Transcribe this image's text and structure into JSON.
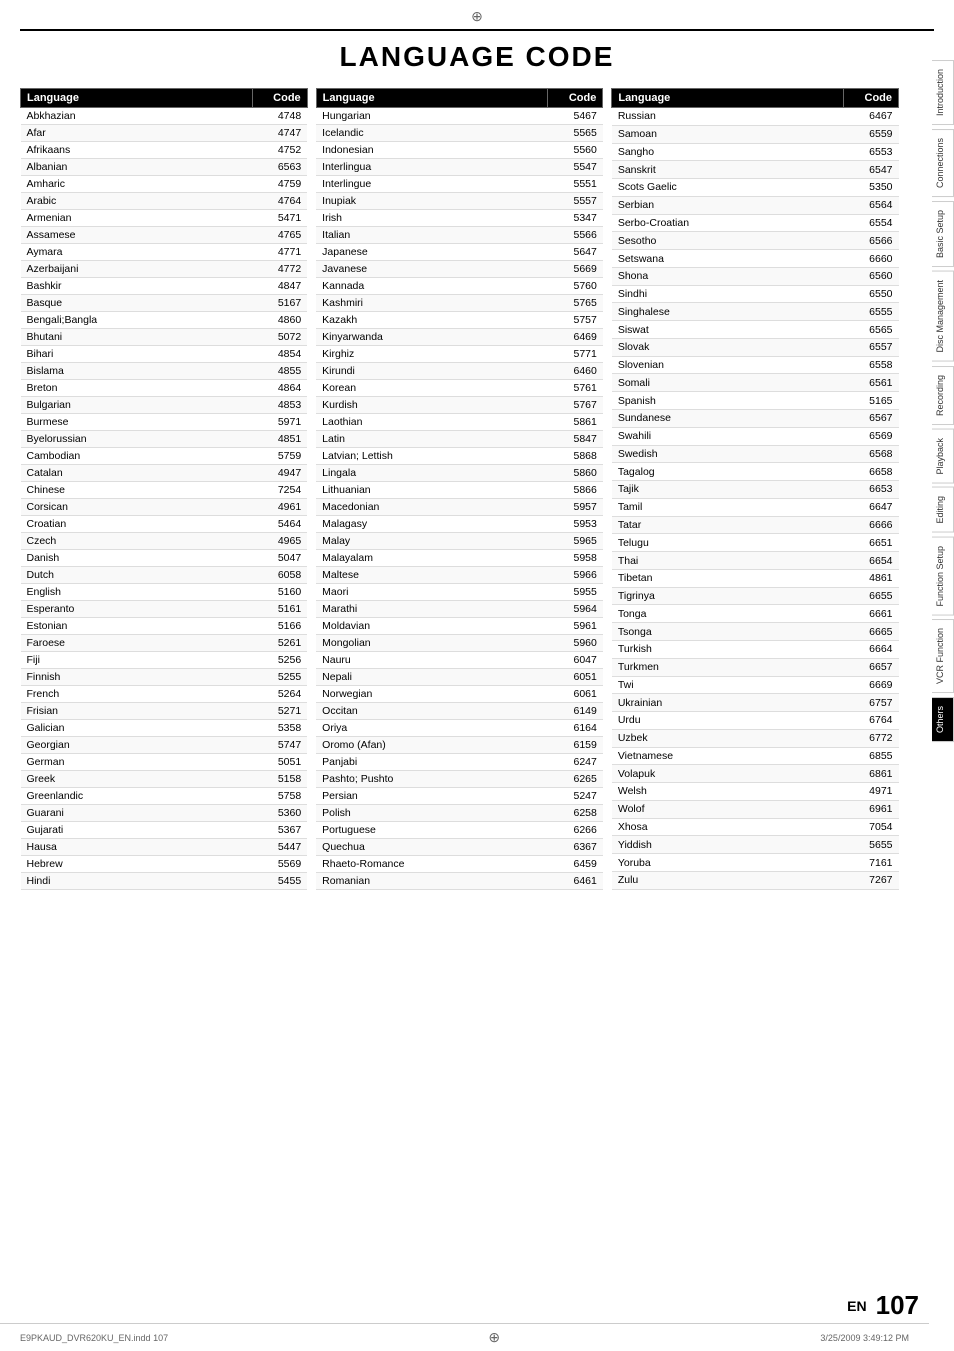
{
  "page": {
    "title": "LANGUAGE CODE",
    "top_marker": "⊕",
    "bottom_marker": "⊕",
    "en_label": "EN",
    "page_num": "107",
    "doc_info": "E9PKAUD_DVR620KU_EN.indd  107",
    "date_info": "3/25/2009  3:49:12 PM"
  },
  "sidebar": {
    "tabs": [
      {
        "label": "Introduction",
        "active": false
      },
      {
        "label": "Connections",
        "active": false
      },
      {
        "label": "Basic Setup",
        "active": false
      },
      {
        "label": "Disc Management",
        "active": false
      },
      {
        "label": "Recording",
        "active": false
      },
      {
        "label": "Playback",
        "active": false
      },
      {
        "label": "Editing",
        "active": false
      },
      {
        "label": "Function Setup",
        "active": false
      },
      {
        "label": "VCR Function",
        "active": false
      },
      {
        "label": "Others",
        "active": true
      }
    ]
  },
  "tables": [
    {
      "header": {
        "language": "Language",
        "code": "Code"
      },
      "rows": [
        {
          "language": "Abkhazian",
          "code": "4748"
        },
        {
          "language": "Afar",
          "code": "4747"
        },
        {
          "language": "Afrikaans",
          "code": "4752"
        },
        {
          "language": "Albanian",
          "code": "6563"
        },
        {
          "language": "Amharic",
          "code": "4759"
        },
        {
          "language": "Arabic",
          "code": "4764"
        },
        {
          "language": "Armenian",
          "code": "5471"
        },
        {
          "language": "Assamese",
          "code": "4765"
        },
        {
          "language": "Aymara",
          "code": "4771"
        },
        {
          "language": "Azerbaijani",
          "code": "4772"
        },
        {
          "language": "Bashkir",
          "code": "4847"
        },
        {
          "language": "Basque",
          "code": "5167"
        },
        {
          "language": "Bengali;Bangla",
          "code": "4860"
        },
        {
          "language": "Bhutani",
          "code": "5072"
        },
        {
          "language": "Bihari",
          "code": "4854"
        },
        {
          "language": "Bislama",
          "code": "4855"
        },
        {
          "language": "Breton",
          "code": "4864"
        },
        {
          "language": "Bulgarian",
          "code": "4853"
        },
        {
          "language": "Burmese",
          "code": "5971"
        },
        {
          "language": "Byelorussian",
          "code": "4851"
        },
        {
          "language": "Cambodian",
          "code": "5759"
        },
        {
          "language": "Catalan",
          "code": "4947"
        },
        {
          "language": "Chinese",
          "code": "7254"
        },
        {
          "language": "Corsican",
          "code": "4961"
        },
        {
          "language": "Croatian",
          "code": "5464"
        },
        {
          "language": "Czech",
          "code": "4965"
        },
        {
          "language": "Danish",
          "code": "5047"
        },
        {
          "language": "Dutch",
          "code": "6058"
        },
        {
          "language": "English",
          "code": "5160"
        },
        {
          "language": "Esperanto",
          "code": "5161"
        },
        {
          "language": "Estonian",
          "code": "5166"
        },
        {
          "language": "Faroese",
          "code": "5261"
        },
        {
          "language": "Fiji",
          "code": "5256"
        },
        {
          "language": "Finnish",
          "code": "5255"
        },
        {
          "language": "French",
          "code": "5264"
        },
        {
          "language": "Frisian",
          "code": "5271"
        },
        {
          "language": "Galician",
          "code": "5358"
        },
        {
          "language": "Georgian",
          "code": "5747"
        },
        {
          "language": "German",
          "code": "5051"
        },
        {
          "language": "Greek",
          "code": "5158"
        },
        {
          "language": "Greenlandic",
          "code": "5758"
        },
        {
          "language": "Guarani",
          "code": "5360"
        },
        {
          "language": "Gujarati",
          "code": "5367"
        },
        {
          "language": "Hausa",
          "code": "5447"
        },
        {
          "language": "Hebrew",
          "code": "5569"
        },
        {
          "language": "Hindi",
          "code": "5455"
        }
      ]
    },
    {
      "header": {
        "language": "Language",
        "code": "Code"
      },
      "rows": [
        {
          "language": "Hungarian",
          "code": "5467"
        },
        {
          "language": "Icelandic",
          "code": "5565"
        },
        {
          "language": "Indonesian",
          "code": "5560"
        },
        {
          "language": "Interlingua",
          "code": "5547"
        },
        {
          "language": "Interlingue",
          "code": "5551"
        },
        {
          "language": "Inupiak",
          "code": "5557"
        },
        {
          "language": "Irish",
          "code": "5347"
        },
        {
          "language": "Italian",
          "code": "5566"
        },
        {
          "language": "Japanese",
          "code": "5647"
        },
        {
          "language": "Javanese",
          "code": "5669"
        },
        {
          "language": "Kannada",
          "code": "5760"
        },
        {
          "language": "Kashmiri",
          "code": "5765"
        },
        {
          "language": "Kazakh",
          "code": "5757"
        },
        {
          "language": "Kinyarwanda",
          "code": "6469"
        },
        {
          "language": "Kirghiz",
          "code": "5771"
        },
        {
          "language": "Kirundi",
          "code": "6460"
        },
        {
          "language": "Korean",
          "code": "5761"
        },
        {
          "language": "Kurdish",
          "code": "5767"
        },
        {
          "language": "Laothian",
          "code": "5861"
        },
        {
          "language": "Latin",
          "code": "5847"
        },
        {
          "language": "Latvian; Lettish",
          "code": "5868"
        },
        {
          "language": "Lingala",
          "code": "5860"
        },
        {
          "language": "Lithuanian",
          "code": "5866"
        },
        {
          "language": "Macedonian",
          "code": "5957"
        },
        {
          "language": "Malagasy",
          "code": "5953"
        },
        {
          "language": "Malay",
          "code": "5965"
        },
        {
          "language": "Malayalam",
          "code": "5958"
        },
        {
          "language": "Maltese",
          "code": "5966"
        },
        {
          "language": "Maori",
          "code": "5955"
        },
        {
          "language": "Marathi",
          "code": "5964"
        },
        {
          "language": "Moldavian",
          "code": "5961"
        },
        {
          "language": "Mongolian",
          "code": "5960"
        },
        {
          "language": "Nauru",
          "code": "6047"
        },
        {
          "language": "Nepali",
          "code": "6051"
        },
        {
          "language": "Norwegian",
          "code": "6061"
        },
        {
          "language": "Occitan",
          "code": "6149"
        },
        {
          "language": "Oriya",
          "code": "6164"
        },
        {
          "language": "Oromo (Afan)",
          "code": "6159"
        },
        {
          "language": "Panjabi",
          "code": "6247"
        },
        {
          "language": "Pashto; Pushto",
          "code": "6265"
        },
        {
          "language": "Persian",
          "code": "5247"
        },
        {
          "language": "Polish",
          "code": "6258"
        },
        {
          "language": "Portuguese",
          "code": "6266"
        },
        {
          "language": "Quechua",
          "code": "6367"
        },
        {
          "language": "Rhaeto-Romance",
          "code": "6459"
        },
        {
          "language": "Romanian",
          "code": "6461"
        }
      ]
    },
    {
      "header": {
        "language": "Language",
        "code": "Code"
      },
      "rows": [
        {
          "language": "Russian",
          "code": "6467"
        },
        {
          "language": "Samoan",
          "code": "6559"
        },
        {
          "language": "Sangho",
          "code": "6553"
        },
        {
          "language": "Sanskrit",
          "code": "6547"
        },
        {
          "language": "Scots Gaelic",
          "code": "5350"
        },
        {
          "language": "Serbian",
          "code": "6564"
        },
        {
          "language": "Serbo-Croatian",
          "code": "6554"
        },
        {
          "language": "Sesotho",
          "code": "6566"
        },
        {
          "language": "Setswana",
          "code": "6660"
        },
        {
          "language": "Shona",
          "code": "6560"
        },
        {
          "language": "Sindhi",
          "code": "6550"
        },
        {
          "language": "Singhalese",
          "code": "6555"
        },
        {
          "language": "Siswat",
          "code": "6565"
        },
        {
          "language": "Slovak",
          "code": "6557"
        },
        {
          "language": "Slovenian",
          "code": "6558"
        },
        {
          "language": "Somali",
          "code": "6561"
        },
        {
          "language": "Spanish",
          "code": "5165"
        },
        {
          "language": "Sundanese",
          "code": "6567"
        },
        {
          "language": "Swahili",
          "code": "6569"
        },
        {
          "language": "Swedish",
          "code": "6568"
        },
        {
          "language": "Tagalog",
          "code": "6658"
        },
        {
          "language": "Tajik",
          "code": "6653"
        },
        {
          "language": "Tamil",
          "code": "6647"
        },
        {
          "language": "Tatar",
          "code": "6666"
        },
        {
          "language": "Telugu",
          "code": "6651"
        },
        {
          "language": "Thai",
          "code": "6654"
        },
        {
          "language": "Tibetan",
          "code": "4861"
        },
        {
          "language": "Tigrinya",
          "code": "6655"
        },
        {
          "language": "Tonga",
          "code": "6661"
        },
        {
          "language": "Tsonga",
          "code": "6665"
        },
        {
          "language": "Turkish",
          "code": "6664"
        },
        {
          "language": "Turkmen",
          "code": "6657"
        },
        {
          "language": "Twi",
          "code": "6669"
        },
        {
          "language": "Ukrainian",
          "code": "6757"
        },
        {
          "language": "Urdu",
          "code": "6764"
        },
        {
          "language": "Uzbek",
          "code": "6772"
        },
        {
          "language": "Vietnamese",
          "code": "6855"
        },
        {
          "language": "Volapuk",
          "code": "6861"
        },
        {
          "language": "Welsh",
          "code": "4971"
        },
        {
          "language": "Wolof",
          "code": "6961"
        },
        {
          "language": "Xhosa",
          "code": "7054"
        },
        {
          "language": "Yiddish",
          "code": "5655"
        },
        {
          "language": "Yoruba",
          "code": "7161"
        },
        {
          "language": "Zulu",
          "code": "7267"
        }
      ]
    }
  ]
}
